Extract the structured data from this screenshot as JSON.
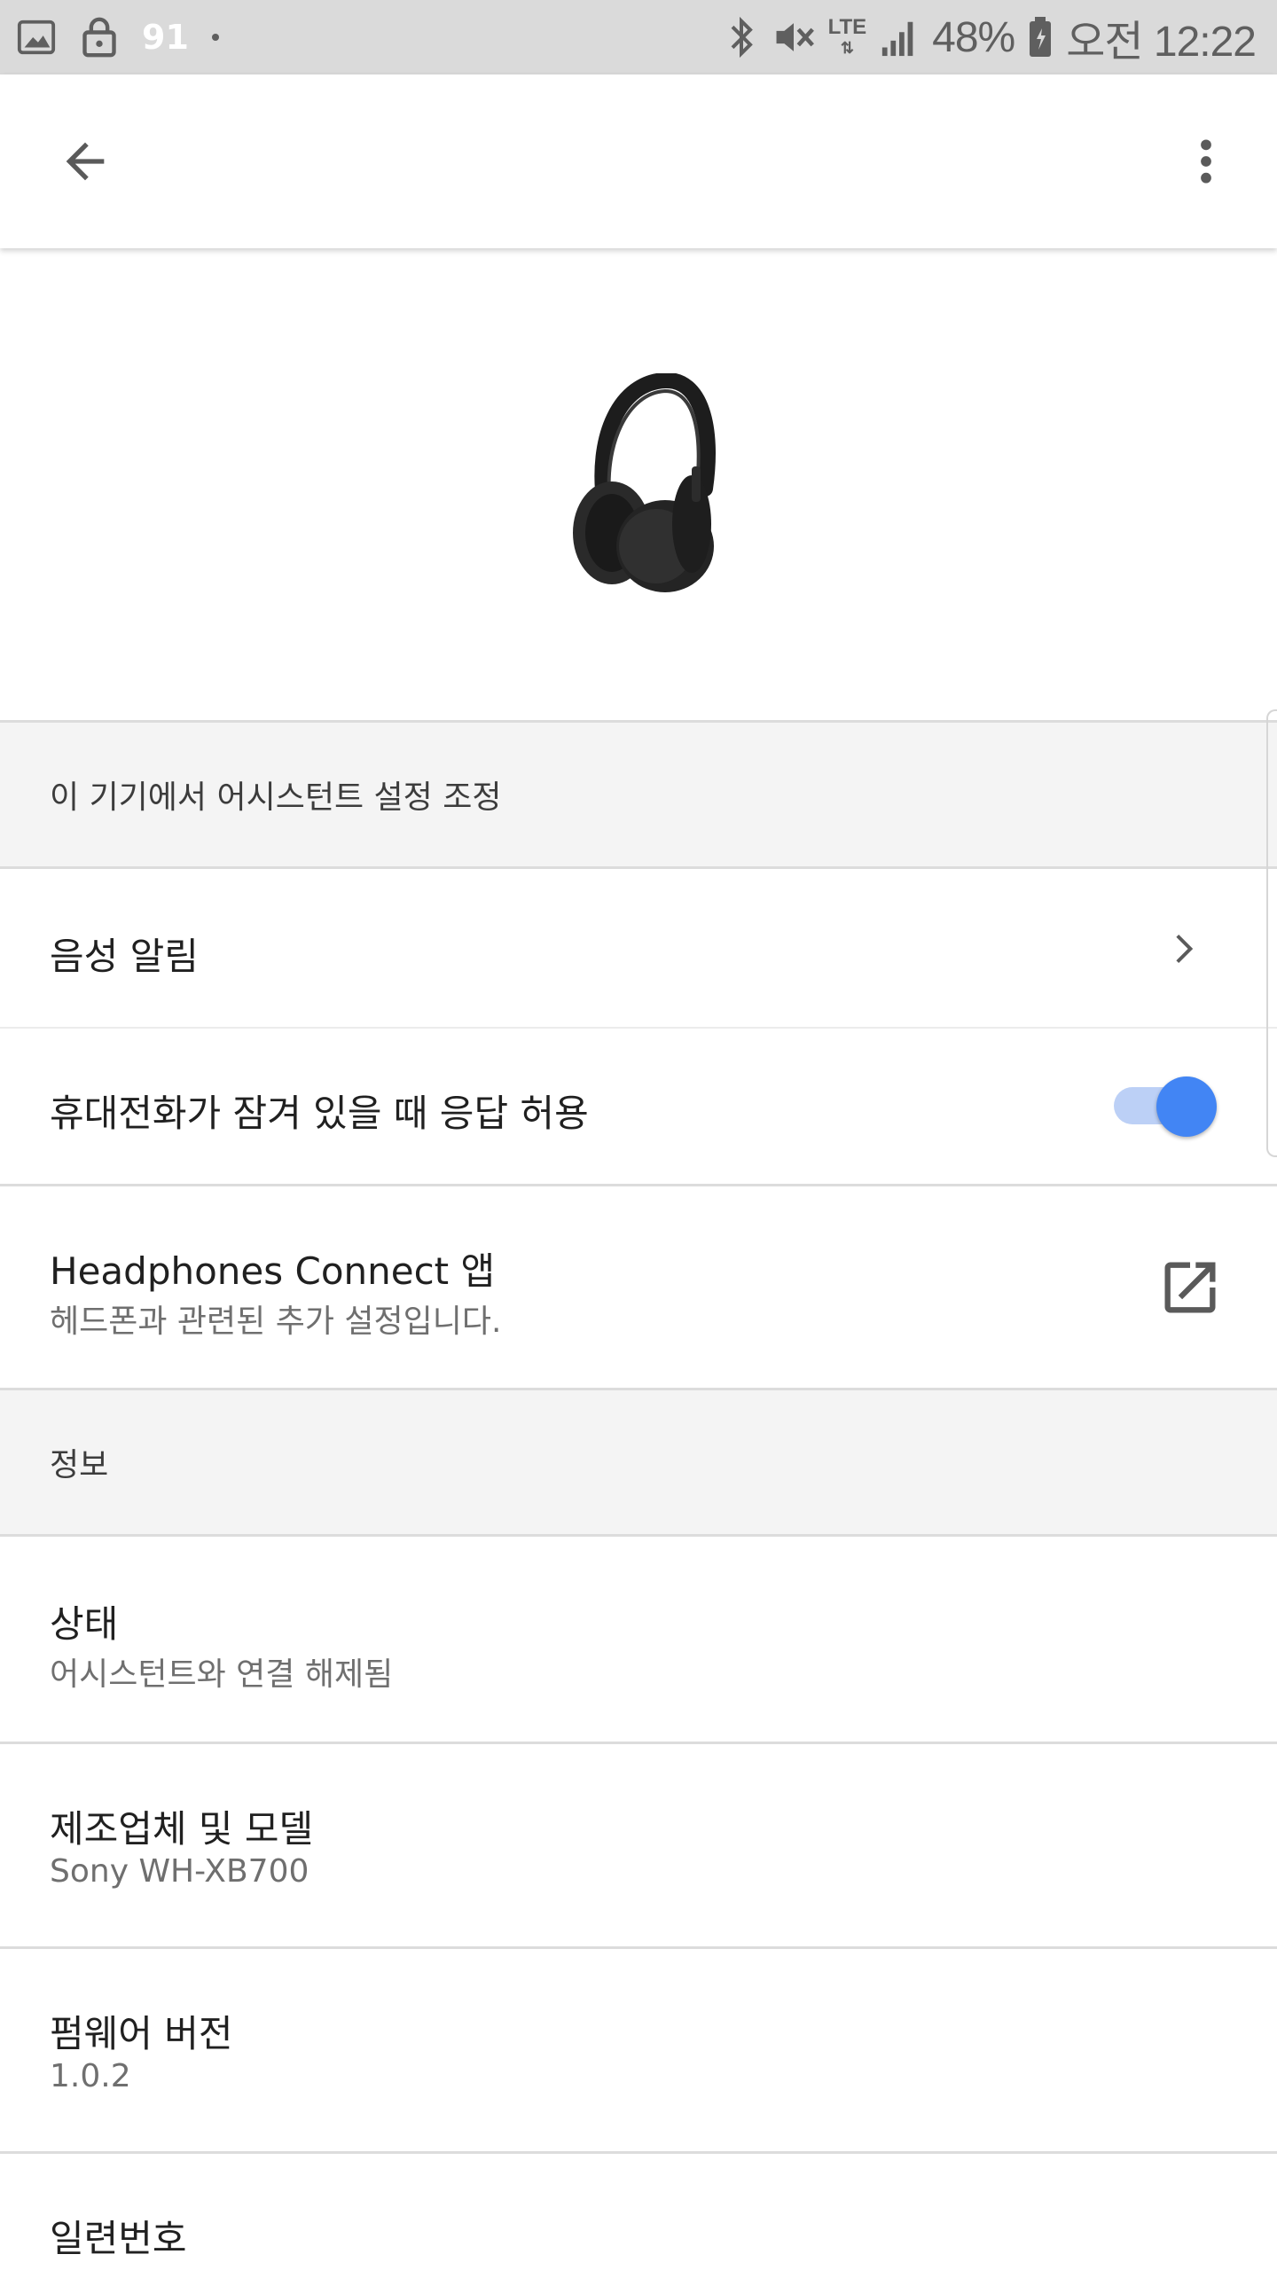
{
  "status_bar": {
    "notification_count": "91",
    "battery": "48%",
    "network": "LTE",
    "time": "오전 12:22"
  },
  "app_bar": {
    "back_icon": "arrow-back-icon",
    "menu_icon": "more-vert-icon"
  },
  "hero": {
    "image": "headphones-image"
  },
  "sections": {
    "assistant_header": "이 기기에서 어시스턴트 설정 조정",
    "voice_alerts": "음성 알림",
    "locked_response": "휴대전화가 잠겨 있을 때 응답 허용",
    "locked_response_enabled": true,
    "app_link": {
      "title": "Headphones Connect 앱",
      "subtitle": "헤드폰과 관련된 추가 설정입니다."
    },
    "info_header": "정보",
    "status": {
      "title": "상태",
      "value": "어시스턴트와 연결 해제됨"
    },
    "maker_model": {
      "title": "제조업체 및 모델",
      "value": "Sony WH-XB700"
    },
    "firmware": {
      "title": "펌웨어 버전",
      "value": "1.0.2"
    },
    "serial": {
      "title": "일련번호"
    }
  },
  "colors": {
    "accent": "#4285f4",
    "accent_track": "#bcd0f6",
    "section_bg": "#f4f4f4",
    "status_bar_bg": "#dadada"
  }
}
